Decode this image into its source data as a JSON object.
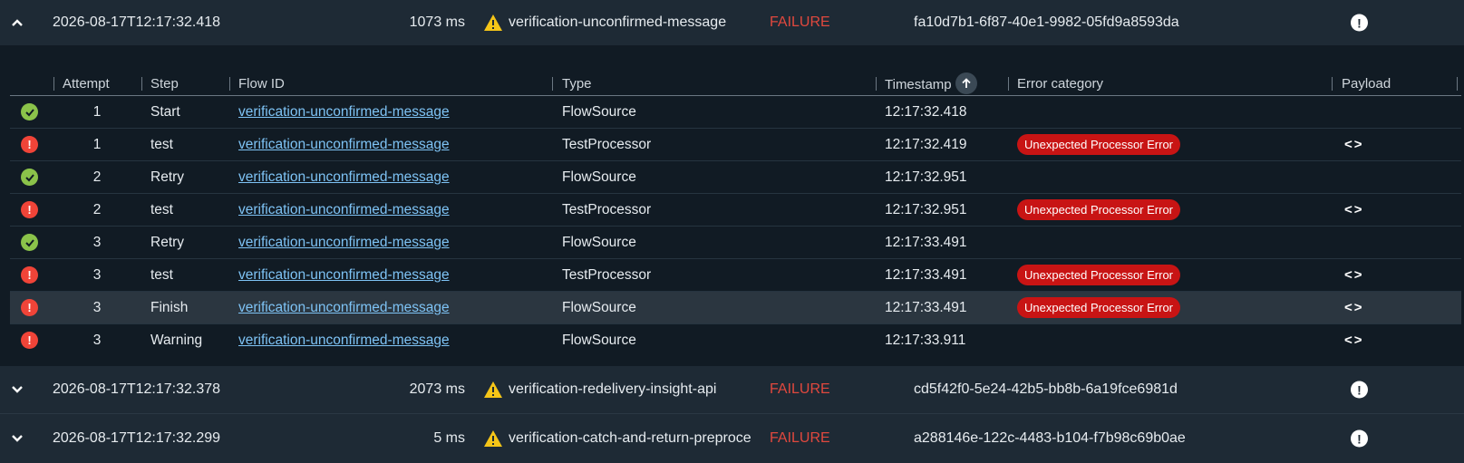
{
  "runs": [
    {
      "timestamp": "2026-08-17T12:17:32.418",
      "duration": "1073 ms",
      "flow": "verification-unconfirmed-message",
      "status": "FAILURE",
      "did": "fa10d7b1-6f87-40e1-9982-05fd9a8593da",
      "expanded": true
    },
    {
      "timestamp": "2026-08-17T12:17:32.378",
      "duration": "2073 ms",
      "flow": "verification-redelivery-insight-api",
      "status": "FAILURE",
      "did": "cd5f42f0-5e24-42b5-bb8b-6a19fce6981d",
      "expanded": false
    },
    {
      "timestamp": "2026-08-17T12:17:32.299",
      "duration": "5 ms",
      "flow": "verification-catch-and-return-preprocessor",
      "status": "FAILURE",
      "did": "a288146e-122c-4483-b104-f7b98c69b0ae",
      "expanded": false
    }
  ],
  "table": {
    "headers": {
      "attempt": "Attempt",
      "step": "Step",
      "flow_id": "Flow ID",
      "type": "Type",
      "timestamp": "Timestamp",
      "error_category": "Error category",
      "payload": "Payload"
    },
    "rows": [
      {
        "status": "success",
        "attempt": "1",
        "step": "Start",
        "flow": "verification-unconfirmed-message",
        "type": "FlowSource",
        "time": "12:17:32.418",
        "error": "",
        "payload": ""
      },
      {
        "status": "error",
        "attempt": "1",
        "step": "test",
        "flow": "verification-unconfirmed-message",
        "type": "TestProcessor",
        "time": "12:17:32.419",
        "error": "Unexpected Processor Error",
        "payload": "<>"
      },
      {
        "status": "success",
        "attempt": "2",
        "step": "Retry",
        "flow": "verification-unconfirmed-message",
        "type": "FlowSource",
        "time": "12:17:32.951",
        "error": "",
        "payload": ""
      },
      {
        "status": "error",
        "attempt": "2",
        "step": "test",
        "flow": "verification-unconfirmed-message",
        "type": "TestProcessor",
        "time": "12:17:32.951",
        "error": "Unexpected Processor Error",
        "payload": "<>"
      },
      {
        "status": "success",
        "attempt": "3",
        "step": "Retry",
        "flow": "verification-unconfirmed-message",
        "type": "FlowSource",
        "time": "12:17:33.491",
        "error": "",
        "payload": ""
      },
      {
        "status": "error",
        "attempt": "3",
        "step": "test",
        "flow": "verification-unconfirmed-message",
        "type": "TestProcessor",
        "time": "12:17:33.491",
        "error": "Unexpected Processor Error",
        "payload": "<>"
      },
      {
        "status": "error",
        "attempt": "3",
        "step": "Finish",
        "flow": "verification-unconfirmed-message",
        "type": "FlowSource",
        "time": "12:17:33.491",
        "error": "Unexpected Processor Error",
        "payload": "<>",
        "highlighted": true
      },
      {
        "status": "error",
        "attempt": "3",
        "step": "Warning",
        "flow": "verification-unconfirmed-message",
        "type": "FlowSource",
        "time": "12:17:33.911",
        "error": "",
        "payload": "<>"
      }
    ]
  },
  "colors": {
    "failure": "#e0483e",
    "link": "#7ec3f5",
    "badge": "#c81414",
    "success_icon": "#8bc34a",
    "error_icon": "#f04438",
    "warning_icon": "#f5c518"
  },
  "icons": {
    "expanded": "chevron-up-icon",
    "collapsed": "chevron-down-icon",
    "warning": "warning-triangle-icon",
    "alert": "exclamation-circle-icon",
    "success": "check-circle-icon",
    "error": "error-circle-icon",
    "sort": "arrow-up-icon",
    "payload": "code-icon"
  }
}
